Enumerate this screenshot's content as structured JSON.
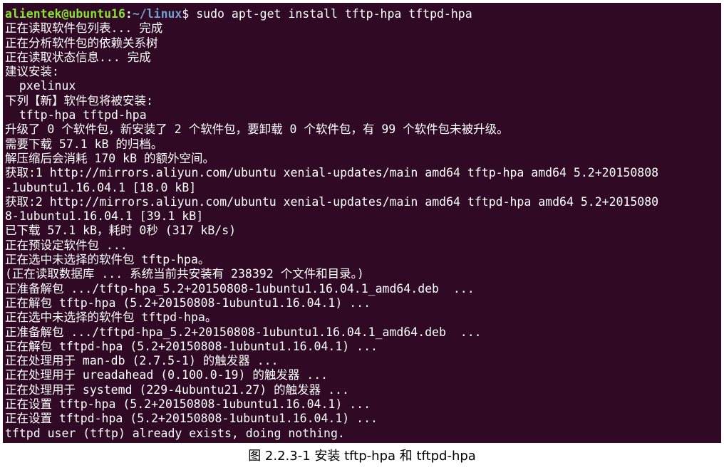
{
  "terminal": {
    "prompt": {
      "user_host": "alientek@ubuntu16",
      "colon": ":",
      "path": "~/linux",
      "symbol": "$",
      "command": " sudo apt-get install tftp-hpa tftpd-hpa"
    },
    "lines": [
      "正在读取软件包列表... 完成",
      "正在分析软件包的依赖关系树",
      "正在读取状态信息... 完成",
      "建议安装:",
      "  pxelinux",
      "下列【新】软件包将被安装:",
      "  tftp-hpa tftpd-hpa",
      "升级了 0 个软件包，新安装了 2 个软件包，要卸载 0 个软件包，有 99 个软件包未被升级。",
      "需要下载 57.1 kB 的归档。",
      "解压缩后会消耗 170 kB 的额外空间。",
      "获取:1 http://mirrors.aliyun.com/ubuntu xenial-updates/main amd64 tftp-hpa amd64 5.2+20150808",
      "-1ubuntu1.16.04.1 [18.0 kB]",
      "获取:2 http://mirrors.aliyun.com/ubuntu xenial-updates/main amd64 tftpd-hpa amd64 5.2+2015080",
      "8-1ubuntu1.16.04.1 [39.1 kB]",
      "已下载 57.1 kB，耗时 0秒 (317 kB/s)",
      "正在预设定软件包 ...",
      "正在选中未选择的软件包 tftp-hpa。",
      "(正在读取数据库 ... 系统当前共安装有 238392 个文件和目录。)",
      "正准备解包 .../tftp-hpa_5.2+20150808-1ubuntu1.16.04.1_amd64.deb  ...",
      "正在解包 tftp-hpa (5.2+20150808-1ubuntu1.16.04.1) ...",
      "正在选中未选择的软件包 tftpd-hpa。",
      "正准备解包 .../tftpd-hpa_5.2+20150808-1ubuntu1.16.04.1_amd64.deb  ...",
      "正在解包 tftpd-hpa (5.2+20150808-1ubuntu1.16.04.1) ...",
      "正在处理用于 man-db (2.7.5-1) 的触发器 ...",
      "正在处理用于 ureadahead (0.100.0-19) 的触发器 ...",
      "正在处理用于 systemd (229-4ubuntu21.27) 的触发器 ...",
      "正在设置 tftp-hpa (5.2+20150808-1ubuntu1.16.04.1) ...",
      "正在设置 tftpd-hpa (5.2+20150808-1ubuntu1.16.04.1) ...",
      "tftpd user (tftp) already exists, doing nothing."
    ]
  },
  "caption": "图 2.2.3-1 安装 tftp-hpa 和 tftpd-hpa",
  "colors": {
    "terminal_bg": "#300a24",
    "text": "#ffffff",
    "user_host": "#8ae234",
    "path": "#729fcf"
  }
}
